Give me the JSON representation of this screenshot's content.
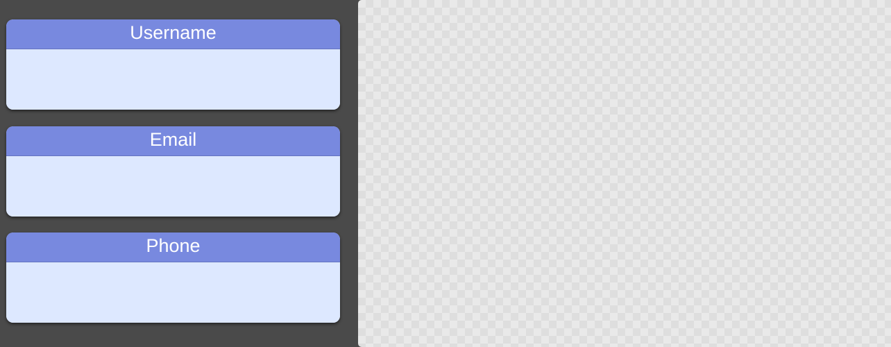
{
  "sidebar": {
    "fields": [
      {
        "label": "Username",
        "value": ""
      },
      {
        "label": "Email",
        "value": ""
      },
      {
        "label": "Phone",
        "value": ""
      }
    ]
  },
  "canvas": {
    "content": ""
  },
  "colors": {
    "background": "#4a4a4a",
    "field_header": "#7889df",
    "field_body": "#dde8ff",
    "canvas_light": "#e9e9e9",
    "canvas_dark": "#dedede"
  }
}
